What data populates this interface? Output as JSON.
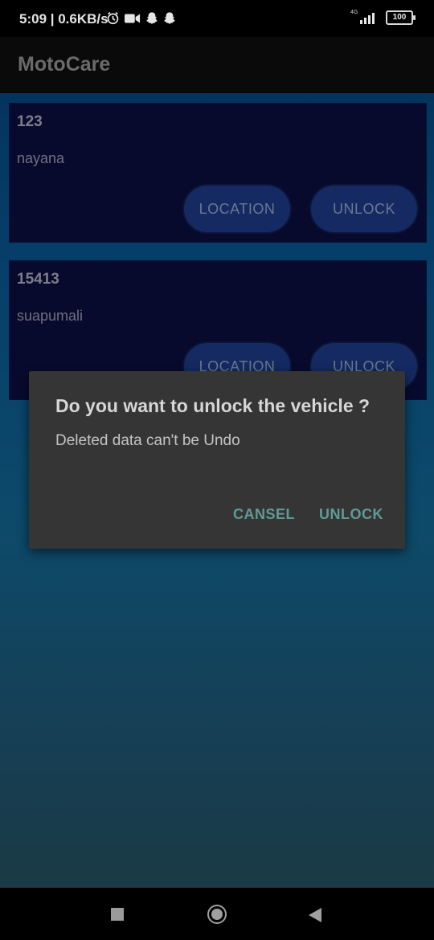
{
  "status_bar": {
    "time_speed": "5:09 | 0.6KB/s",
    "icons": [
      "alarm-icon",
      "video-icon",
      "snapchat-icon",
      "snapchat-icon",
      "signal-icon",
      "battery-icon"
    ],
    "network_label": "4G",
    "battery": "100"
  },
  "app": {
    "title": "MotoCare"
  },
  "vehicles": [
    {
      "id": "123",
      "name": "nayana",
      "location_label": "LOCATION",
      "unlock_label": "UNLOCK"
    },
    {
      "id": "15413",
      "name": "suapumali",
      "location_label": "LOCATION",
      "unlock_label": "UNLOCK"
    }
  ],
  "dialog": {
    "title": "Do you want to unlock the vehicle ?",
    "message": "Deleted data can't be Undo",
    "cancel_label": "CANSEL",
    "confirm_label": "UNLOCK"
  },
  "nav": {
    "icons": [
      "recents-icon",
      "home-icon",
      "back-icon"
    ]
  },
  "colors": {
    "dialog_button": "#5f9b99",
    "card_background": "#080a2d",
    "pill_button": "#152a62"
  }
}
